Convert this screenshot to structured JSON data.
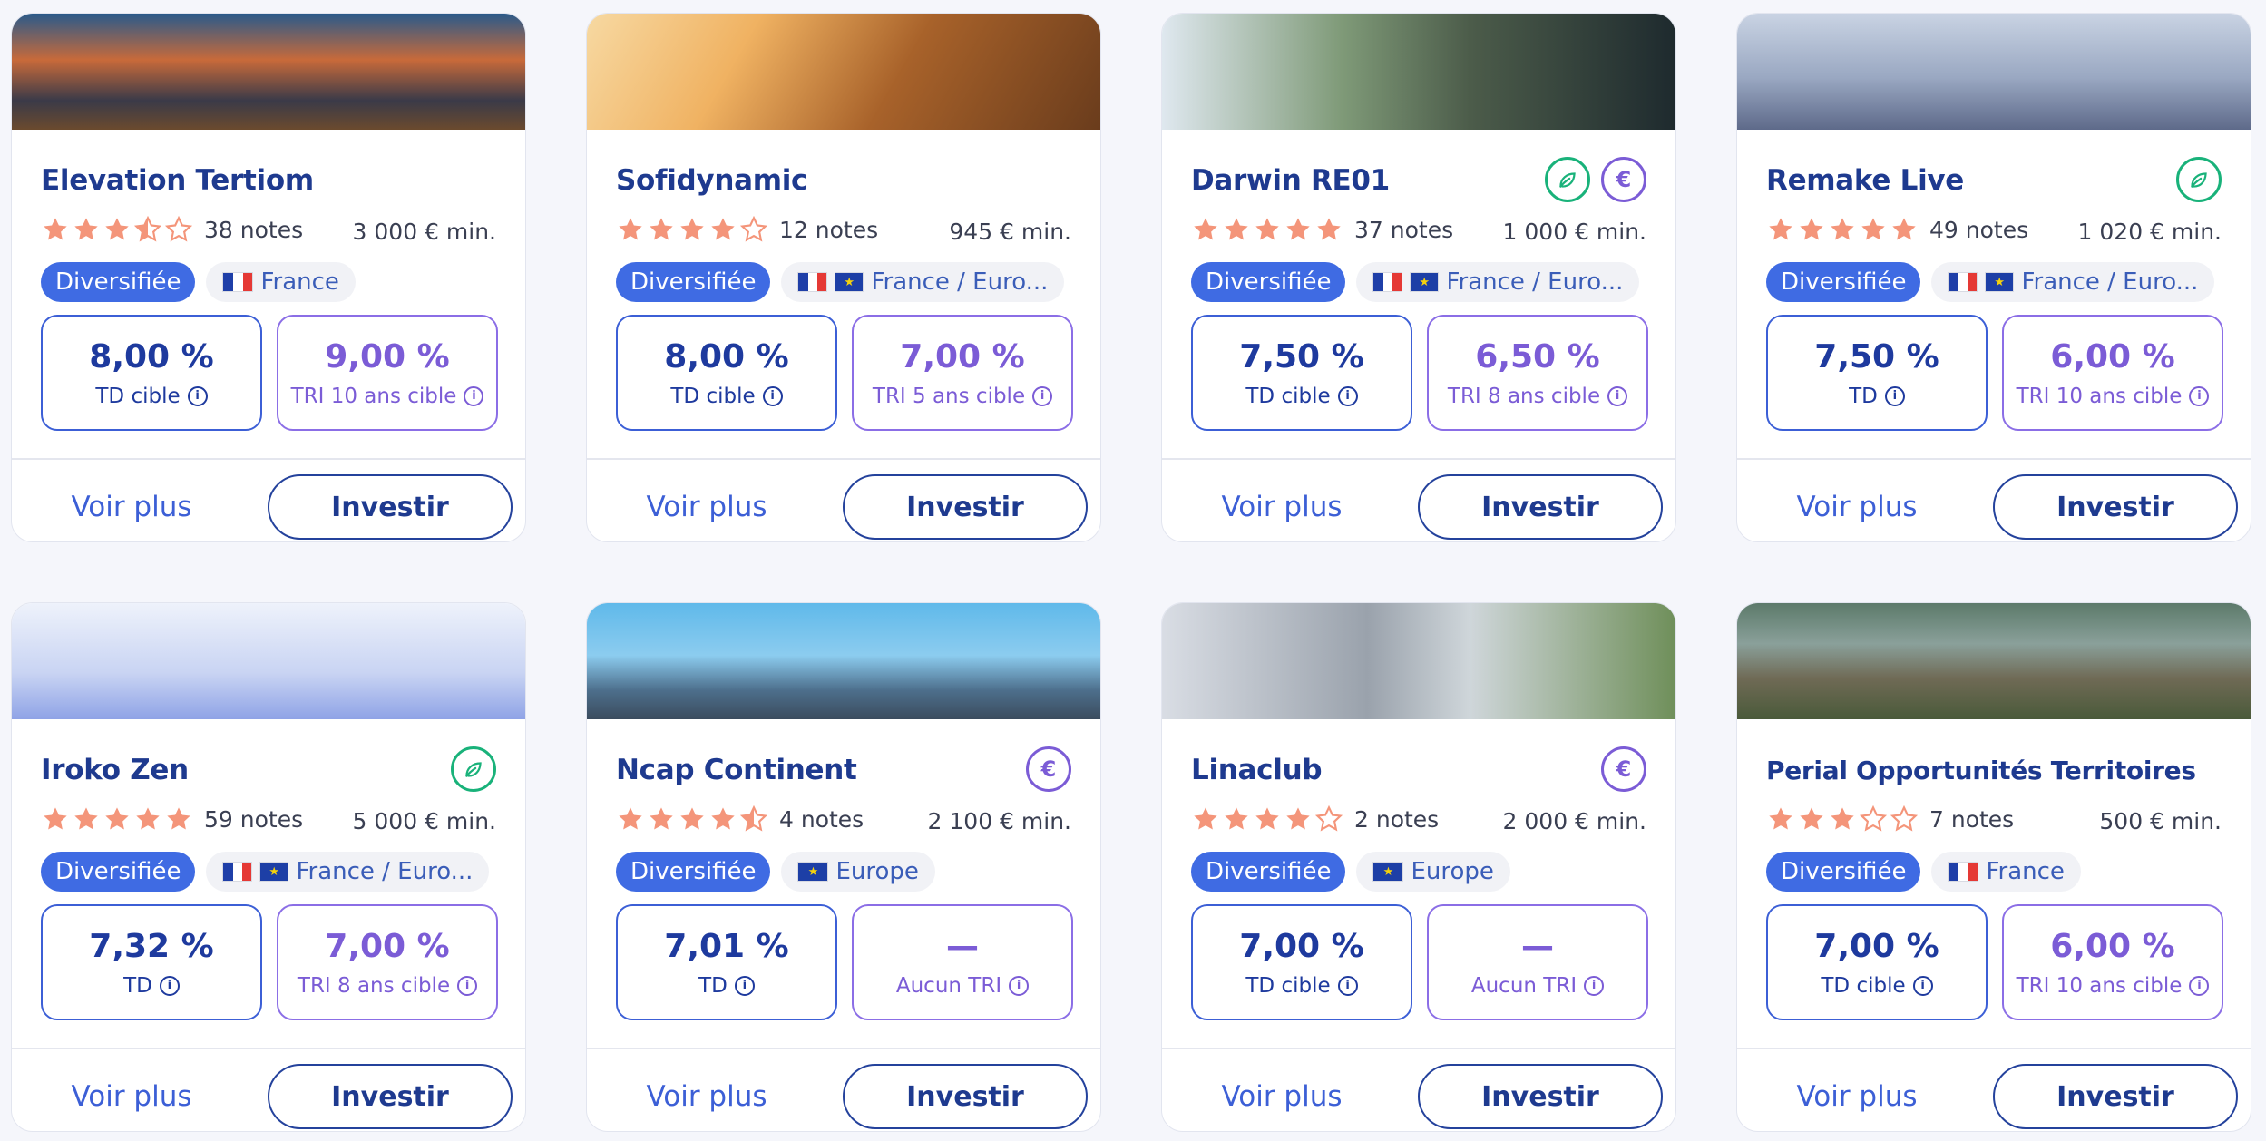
{
  "cards": [
    {
      "name": "Elevation Tertiom",
      "rating": 3.5,
      "notes": "38 notes",
      "min": "3 000 € min.",
      "type": "Diversifiée",
      "flags": [
        "fr"
      ],
      "geo": "France",
      "badges": [],
      "td_value": "8,00 %",
      "td_label": "TD cible",
      "tri_value": "9,00 %",
      "tri_label": "TRI 10 ans cible",
      "voir": "Voir plus",
      "investir": "Investir"
    },
    {
      "name": "Sofidynamic",
      "rating": 4,
      "notes": "12 notes",
      "min": "945 € min.",
      "type": "Diversifiée",
      "flags": [
        "fr",
        "eu"
      ],
      "geo": "France / Euro...",
      "badges": [],
      "td_value": "8,00 %",
      "td_label": "TD cible",
      "tri_value": "7,00 %",
      "tri_label": "TRI 5 ans cible",
      "voir": "Voir plus",
      "investir": "Investir"
    },
    {
      "name": "Darwin RE01",
      "rating": 5,
      "notes": "37 notes",
      "min": "1 000 € min.",
      "type": "Diversifiée",
      "flags": [
        "fr",
        "eu"
      ],
      "geo": "France / Euro...",
      "badges": [
        "leaf-icon",
        "euro-icon"
      ],
      "td_value": "7,50 %",
      "td_label": "TD cible",
      "tri_value": "6,50 %",
      "tri_label": "TRI 8 ans cible",
      "voir": "Voir plus",
      "investir": "Investir"
    },
    {
      "name": "Remake Live",
      "rating": 5,
      "notes": "49 notes",
      "min": "1 020 € min.",
      "type": "Diversifiée",
      "flags": [
        "fr",
        "eu"
      ],
      "geo": "France / Euro...",
      "badges": [
        "leaf-icon"
      ],
      "td_value": "7,50 %",
      "td_label": "TD",
      "tri_value": "6,00 %",
      "tri_label": "TRI 10 ans cible",
      "voir": "Voir plus",
      "investir": "Investir"
    },
    {
      "name": "Iroko Zen",
      "rating": 5,
      "notes": "59 notes",
      "min": "5 000 € min.",
      "type": "Diversifiée",
      "flags": [
        "fr",
        "eu"
      ],
      "geo": "France / Euro...",
      "badges": [
        "leaf-icon"
      ],
      "td_value": "7,32 %",
      "td_label": "TD",
      "tri_value": "7,00 %",
      "tri_label": "TRI 8 ans cible",
      "voir": "Voir plus",
      "investir": "Investir"
    },
    {
      "name": "Ncap Continent",
      "rating": 4.5,
      "notes": "4 notes",
      "min": "2 100 € min.",
      "type": "Diversifiée",
      "flags": [
        "eu"
      ],
      "geo": "Europe",
      "badges": [
        "euro-icon"
      ],
      "td_value": "7,01 %",
      "td_label": "TD",
      "tri_value": "—",
      "tri_label": "Aucun TRI",
      "voir": "Voir plus",
      "investir": "Investir"
    },
    {
      "name": "Linaclub",
      "rating": 4,
      "notes": "2 notes",
      "min": "2 000 € min.",
      "type": "Diversifiée",
      "flags": [
        "eu"
      ],
      "geo": "Europe",
      "badges": [
        "euro-icon"
      ],
      "td_value": "7,00 %",
      "td_label": "TD cible",
      "tri_value": "—",
      "tri_label": "Aucun TRI",
      "voir": "Voir plus",
      "investir": "Investir"
    },
    {
      "name": "Perial Opportunités Territoires",
      "rating": 3,
      "notes": "7 notes",
      "min": "500 € min.",
      "type": "Diversifiée",
      "flags": [
        "fr"
      ],
      "geo": "France",
      "badges": [],
      "td_value": "7,00 %",
      "td_label": "TD cible",
      "tri_value": "6,00 %",
      "tri_label": "TRI 10 ans cible",
      "voir": "Voir plus",
      "investir": "Investir"
    }
  ],
  "colors": {
    "star": "#f4957a",
    "star_empty": "#f4957a",
    "td_border": "#3c5fd6",
    "tri_border": "#8b6ee6",
    "primary": "#3f6be3"
  }
}
